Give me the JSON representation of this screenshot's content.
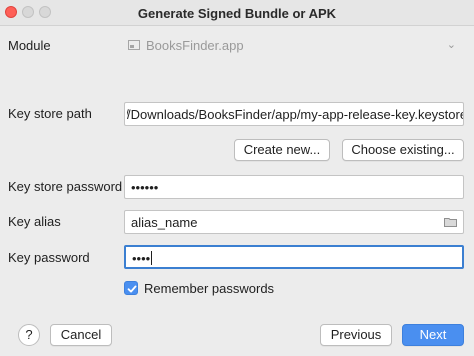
{
  "window": {
    "title": "Generate Signed Bundle or APK"
  },
  "module": {
    "label": "Module",
    "value": "BooksFinder.app",
    "icon": "folder-module-icon"
  },
  "key_store_path": {
    "label": "Key store path",
    "value": "̸/Downloads/BooksFinder/app/my-app-release-key.keystore"
  },
  "buttons": {
    "create_new": "Create new...",
    "choose_existing": "Choose existing...",
    "cancel": "Cancel",
    "previous": "Previous",
    "next": "Next",
    "help": "?"
  },
  "key_store_password": {
    "label": "Key store password",
    "value": "••••••"
  },
  "key_alias": {
    "label": "Key alias",
    "value": "alias_name",
    "icon": "folder-icon"
  },
  "key_password": {
    "label": "Key password",
    "value": "••••"
  },
  "remember": {
    "label": "Remember passwords",
    "checked": true
  },
  "colors": {
    "accent": "#4a8ff0",
    "close": "#fe5f57"
  }
}
